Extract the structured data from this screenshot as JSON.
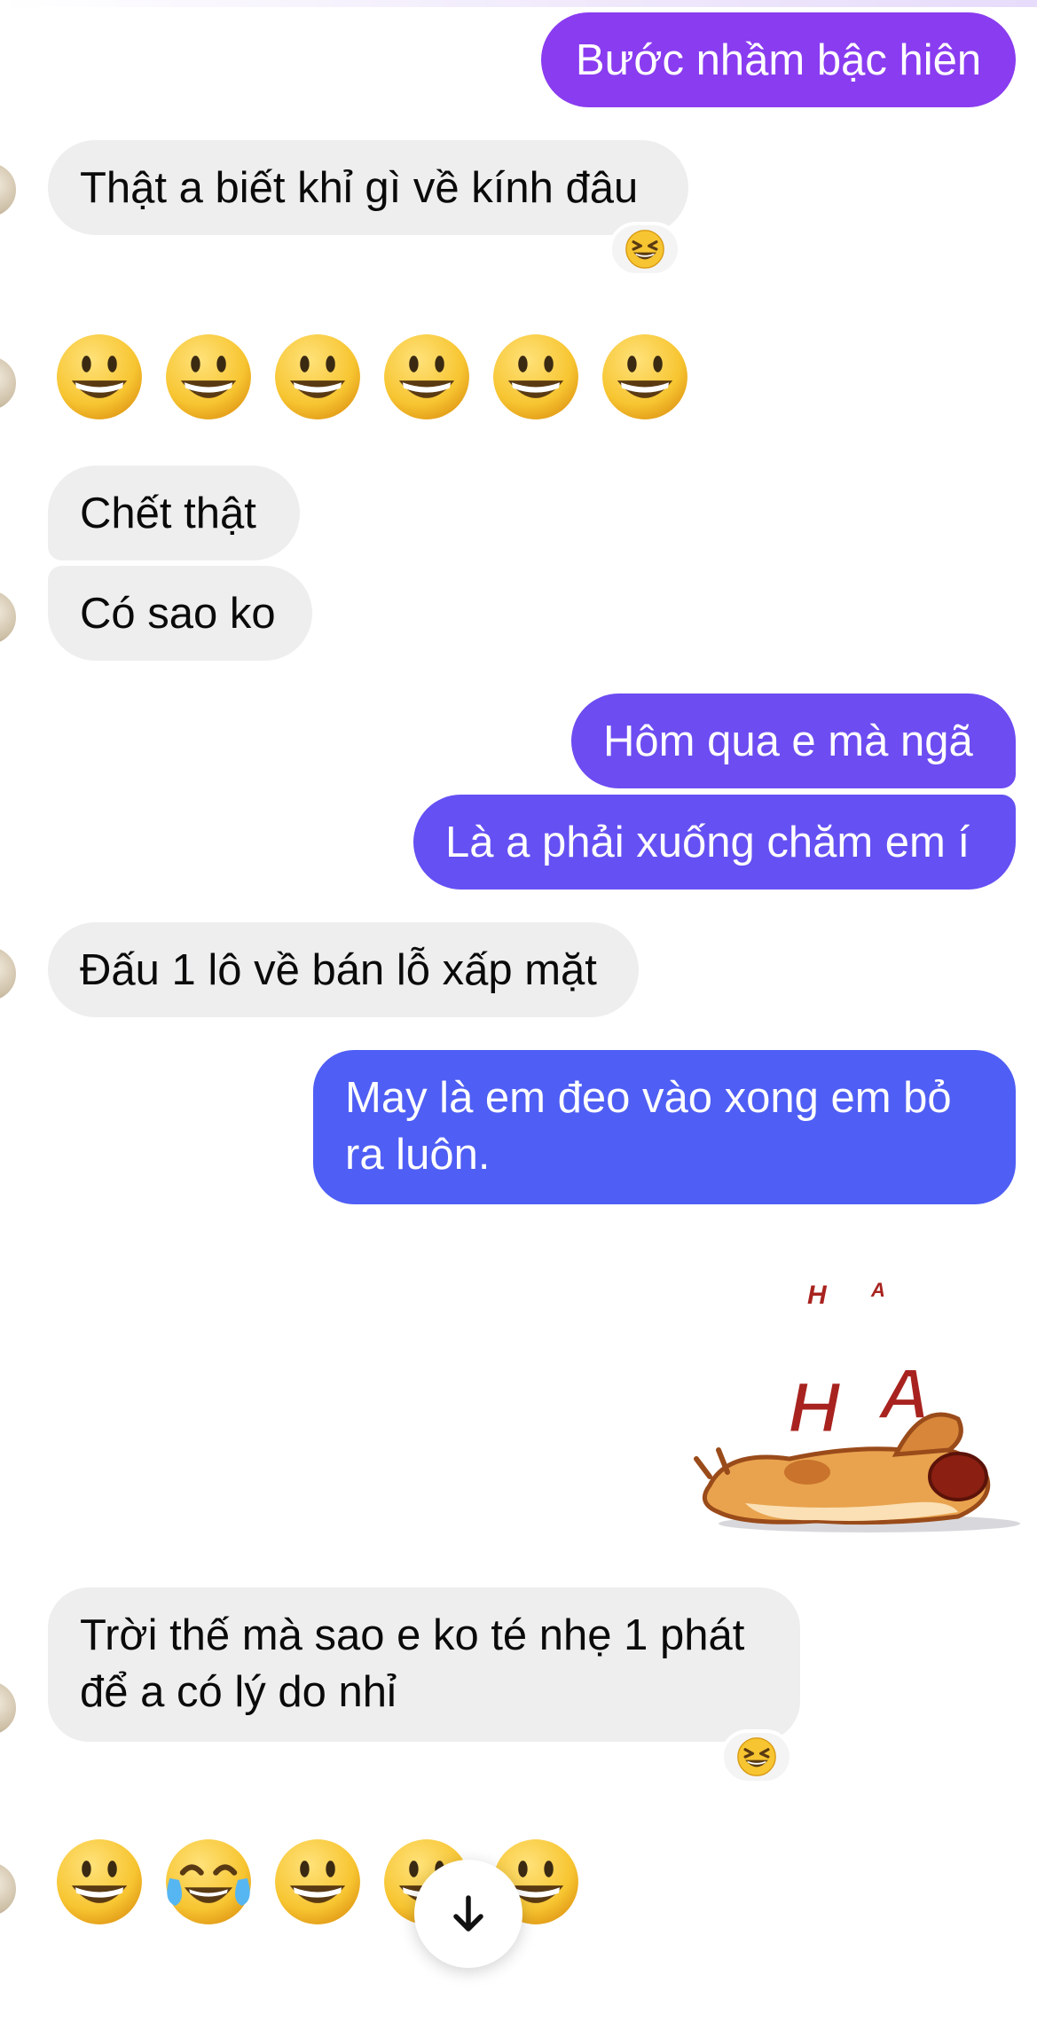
{
  "colors": {
    "incoming_bubble": "#eeeeef",
    "outgoing_top": "#8a3cf0",
    "outgoing_mid": "#6a4df2",
    "outgoing_bottom": "#4f5ef4",
    "emoji_face": "#f7c531"
  },
  "messages": [
    {
      "direction": "outgoing",
      "text": "Bước nhầm bậc hiên"
    },
    {
      "direction": "incoming",
      "text": "Thật a biết khỉ gì về kính đâu",
      "reaction": "grinning-squinting-face"
    },
    {
      "direction": "incoming",
      "emojis": [
        "grinning-face",
        "grinning-face",
        "grinning-face",
        "grinning-face",
        "grinning-face",
        "grinning-face"
      ]
    },
    {
      "direction": "incoming",
      "text": "Chết thật"
    },
    {
      "direction": "incoming",
      "text": "Có sao ko"
    },
    {
      "direction": "outgoing",
      "text": "Hôm qua e mà ngã"
    },
    {
      "direction": "outgoing",
      "text": "Là a phải xuống chăm em í"
    },
    {
      "direction": "incoming",
      "text": "Đấu 1 lô về bán lỗ xấp mặt"
    },
    {
      "direction": "outgoing",
      "text": "May là em đeo vào xong em bỏ ra luôn."
    },
    {
      "direction": "outgoing",
      "sticker": "laughing-dog-sticker",
      "sticker_text": [
        "H",
        "A",
        "H",
        "A"
      ]
    },
    {
      "direction": "incoming",
      "text": "Trời thế mà sao e ko té nhẹ 1 phát để a có lý do nhỉ",
      "reaction": "grinning-squinting-face"
    },
    {
      "direction": "incoming",
      "emojis": [
        "grinning-face",
        "face-with-tears-of-joy",
        "grinning-face",
        "grinning-face",
        "grinning-face"
      ]
    }
  ],
  "scroll_button": {
    "icon": "arrow-down-icon"
  }
}
